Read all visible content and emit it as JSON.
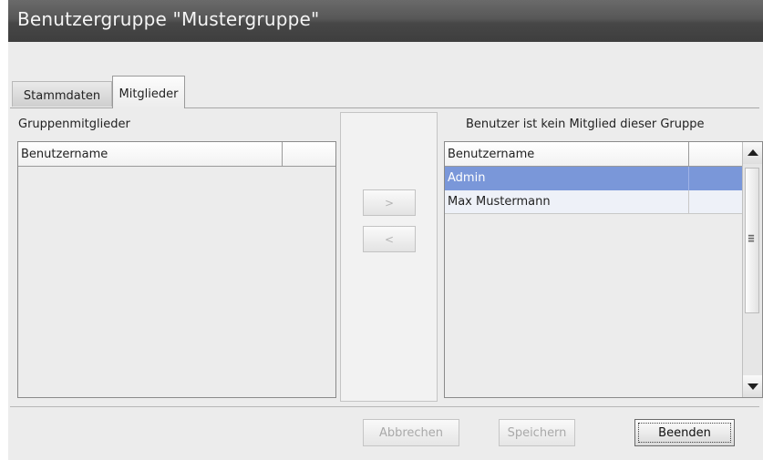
{
  "window": {
    "title": "Benutzergruppe \"Mustergruppe\""
  },
  "tabs": [
    {
      "label": "Stammdaten",
      "active": false
    },
    {
      "label": "Mitglieder",
      "active": true
    }
  ],
  "left_panel": {
    "label": "Gruppenmitglieder",
    "column_header": "Benutzername",
    "rows": []
  },
  "middle_panel": {
    "add_label": ">",
    "remove_label": "<"
  },
  "right_panel": {
    "label": "Benutzer ist kein Mitglied dieser Gruppe",
    "column_header": "Benutzername",
    "rows": [
      {
        "name": "Admin",
        "selected": true
      },
      {
        "name": "Max Mustermann",
        "selected": false
      }
    ]
  },
  "footer": {
    "cancel_label": "Abbrechen",
    "save_label": "Speichern",
    "close_label": "Beenden"
  },
  "colors": {
    "selection": "#7a97d9",
    "titlebar": "#4e4e4e",
    "background": "#ececec"
  }
}
